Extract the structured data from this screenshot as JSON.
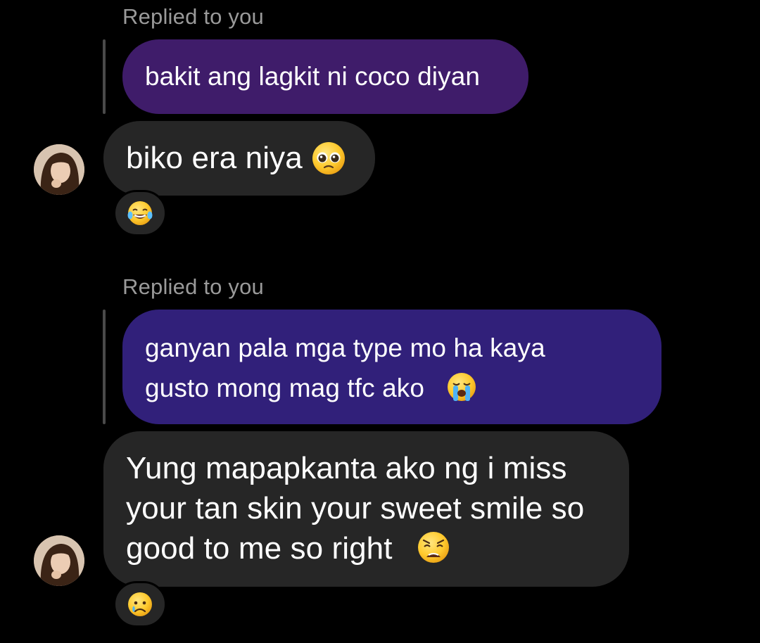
{
  "messages": [
    {
      "reply_label": "Replied to you",
      "quoted_text": "bakit ang lagkit ni coco diyan",
      "reply_text": "biko era niya",
      "reply_emoji": "pleading-face",
      "reaction_emoji": "face-with-tears-of-joy"
    },
    {
      "reply_label": "Replied to you",
      "quoted_lines": [
        "ganyan pala mga type mo ha kaya",
        "gusto mong mag tfc ako"
      ],
      "quoted_emoji": "loudly-crying-face",
      "reply_lines": [
        "Yung mapapkanta ako ng i miss",
        "your tan skin your sweet smile so",
        "good to me so right"
      ],
      "reply_emoji": "weary-face",
      "reaction_emoji": "crying-face"
    }
  ],
  "colors": {
    "background": "#000000",
    "quoted_bubble_1": "#3f1c6a",
    "quoted_bubble_2": "#31207a",
    "incoming_bubble": "#262626",
    "reply_label": "#9a9a9a"
  }
}
